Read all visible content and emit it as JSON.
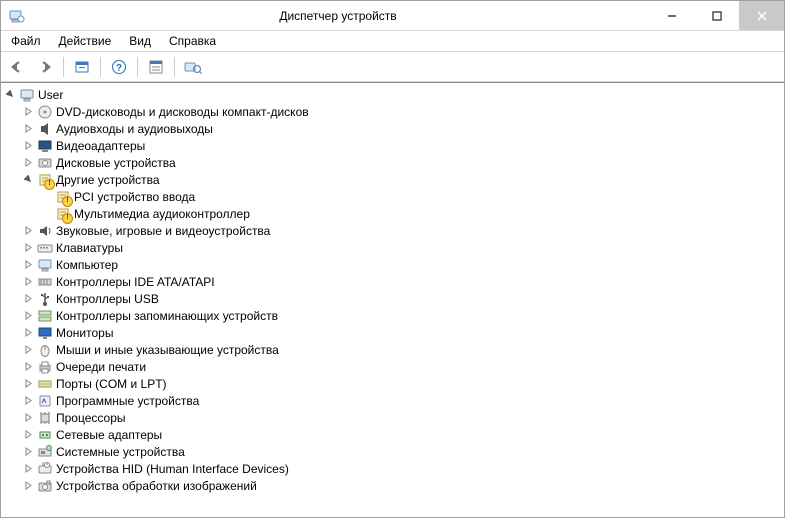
{
  "window": {
    "title": "Диспетчер устройств"
  },
  "menu": {
    "file": "Файл",
    "action": "Действие",
    "view": "Вид",
    "help": "Справка"
  },
  "tree": {
    "root": {
      "label": "User"
    },
    "items": [
      {
        "label": "DVD-дисководы и дисководы компакт-дисков",
        "icon": "optical"
      },
      {
        "label": "Аудиовходы и аудиовыходы",
        "icon": "audio"
      },
      {
        "label": "Видеоадаптеры",
        "icon": "display"
      },
      {
        "label": "Дисковые устройства",
        "icon": "disk"
      },
      {
        "label": "Другие устройства",
        "icon": "other",
        "expanded": true,
        "warn": true,
        "children": [
          {
            "label": "PCI устройство ввода",
            "icon": "other",
            "warn": true
          },
          {
            "label": "Мультимедиа аудиоконтроллер",
            "icon": "other",
            "warn": true
          }
        ]
      },
      {
        "label": "Звуковые, игровые и видеоустройства",
        "icon": "sound"
      },
      {
        "label": "Клавиатуры",
        "icon": "keyboard"
      },
      {
        "label": "Компьютер",
        "icon": "computer"
      },
      {
        "label": "Контроллеры IDE ATA/ATAPI",
        "icon": "ide"
      },
      {
        "label": "Контроллеры USB",
        "icon": "usb"
      },
      {
        "label": "Контроллеры запоминающих устройств",
        "icon": "storagectl"
      },
      {
        "label": "Мониторы",
        "icon": "monitor"
      },
      {
        "label": "Мыши и иные указывающие устройства",
        "icon": "mouse"
      },
      {
        "label": "Очереди печати",
        "icon": "printer"
      },
      {
        "label": "Порты (COM и LPT)",
        "icon": "port"
      },
      {
        "label": "Программные устройства",
        "icon": "software"
      },
      {
        "label": "Процессоры",
        "icon": "cpu"
      },
      {
        "label": "Сетевые адаптеры",
        "icon": "network"
      },
      {
        "label": "Системные устройства",
        "icon": "system"
      },
      {
        "label": "Устройства HID (Human Interface Devices)",
        "icon": "hid"
      },
      {
        "label": "Устройства обработки изображений",
        "icon": "imaging"
      }
    ]
  }
}
